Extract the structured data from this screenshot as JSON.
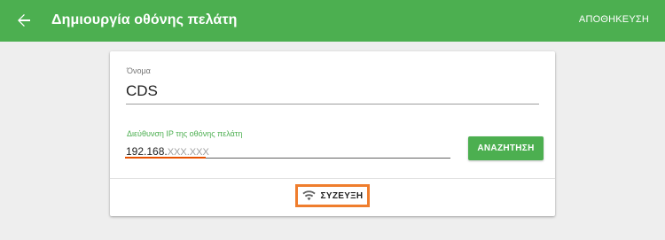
{
  "appbar": {
    "title": "Δημιουργία οθόνης πελάτη",
    "save_label": "ΑΠΟΘΗΚΕΥΣΗ",
    "back_icon": "arrow-back-icon",
    "color": "#4caf50"
  },
  "form": {
    "name": {
      "label": "Όνομα",
      "value": "CDS"
    },
    "ip": {
      "label": "Διεύθυνση IP της οθόνης πελάτη",
      "value": "192.168.",
      "placeholder": "XXX.XXX"
    },
    "search_label": "ΑΝΑΖΗΤΗΣΗ",
    "connect": {
      "icon": "wifi-icon",
      "label": "ΣΥΖΕΥΞΗ"
    }
  },
  "colors": {
    "accent": "#4caf50",
    "highlight": "#ef7d2d"
  }
}
